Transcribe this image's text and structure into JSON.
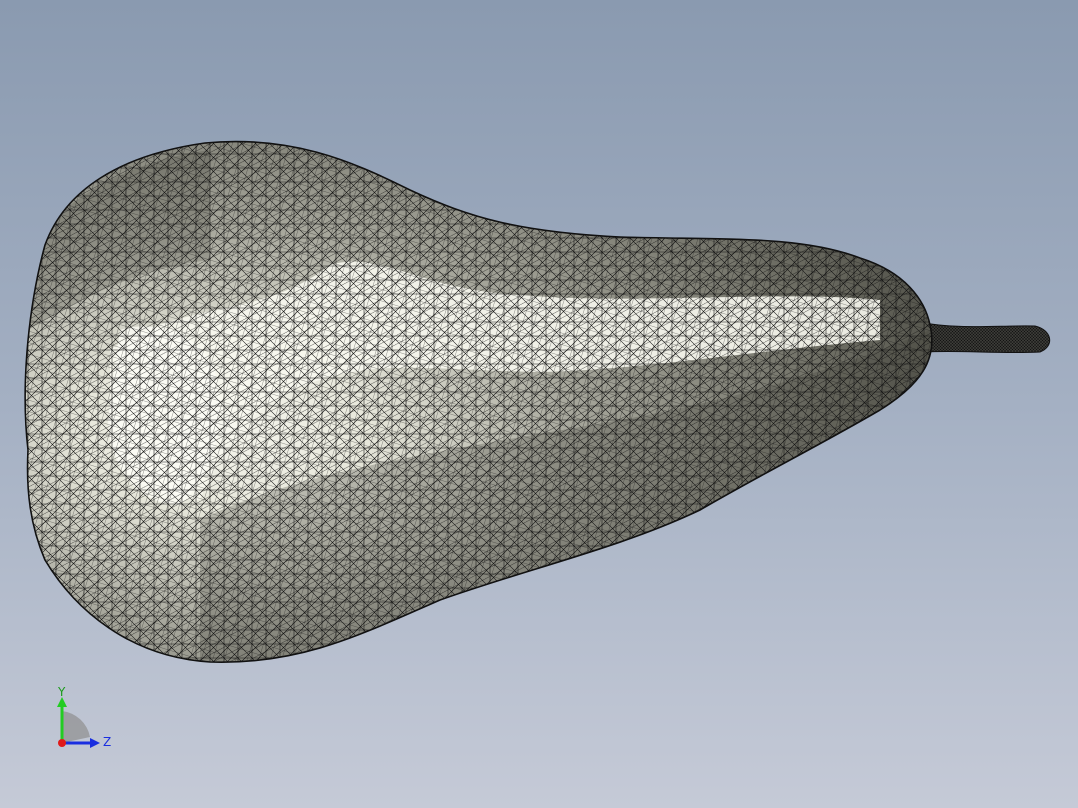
{
  "viewport": {
    "model_name": "",
    "colors": {
      "background_top": "#8a9ab0",
      "background_bottom": "#c5cad7",
      "mesh_edges": "#111111",
      "body_light": "#f6f6ee",
      "body_mid": "#a7a79c",
      "body_dark": "#4e4e46"
    }
  },
  "triad": {
    "y_label": "Y",
    "z_label": "Z",
    "colors": {
      "y": "#22cc22",
      "z": "#1a2ee0",
      "x": "#e01a1a"
    }
  }
}
